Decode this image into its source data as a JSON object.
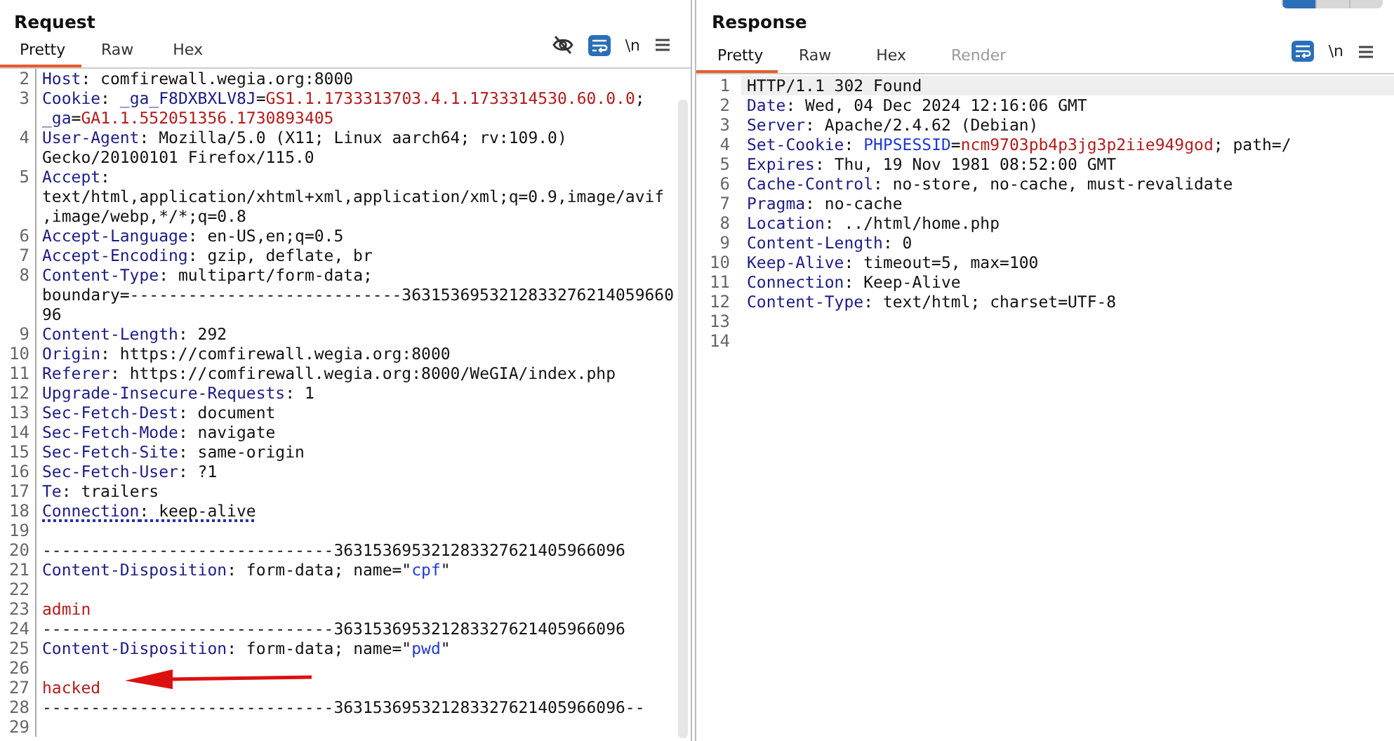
{
  "layout_buttons": [
    {
      "selected": true
    },
    {
      "selected": false
    },
    {
      "selected": false
    }
  ],
  "panels": [
    {
      "kind": "request",
      "title": "Request",
      "tabs": [
        {
          "label": "Pretty",
          "selected": true,
          "disabled": false
        },
        {
          "label": "Raw",
          "selected": false,
          "disabled": false
        },
        {
          "label": "Hex",
          "selected": false,
          "disabled": false
        }
      ],
      "tools": [
        {
          "kind": "hide"
        },
        {
          "kind": "wrap",
          "on": true
        },
        {
          "kind": "newline",
          "label": "\\n"
        },
        {
          "kind": "menu"
        }
      ],
      "lines": [
        {
          "number": "2",
          "marked": false,
          "highlighted": false,
          "rows": [
            {
              "segments": [
                {
                  "kind": "name",
                  "text": "Host"
                },
                {
                  "kind": "plain",
                  "text": ": comfirewall.wegia.org:8000"
                }
              ]
            }
          ]
        },
        {
          "number": "3",
          "marked": false,
          "highlighted": false,
          "rows": [
            {
              "segments": [
                {
                  "kind": "name",
                  "text": "Cookie"
                },
                {
                  "kind": "plain",
                  "text": ": "
                },
                {
                  "kind": "name",
                  "text": "_ga_F8DXBXLV8J"
                },
                {
                  "kind": "plain",
                  "text": "="
                },
                {
                  "kind": "value",
                  "text": "GS1.1.1733313703.4.1.1733314530.60.0.0"
                },
                {
                  "kind": "plain",
                  "text": ";"
                }
              ]
            },
            {
              "segments": [
                {
                  "kind": "name",
                  "text": "_ga"
                },
                {
                  "kind": "plain",
                  "text": "="
                },
                {
                  "kind": "value",
                  "text": "GA1.1.552051356.1730893405"
                }
              ]
            }
          ]
        },
        {
          "number": "4",
          "marked": false,
          "highlighted": false,
          "rows": [
            {
              "segments": [
                {
                  "kind": "name",
                  "text": "User-Agent"
                },
                {
                  "kind": "plain",
                  "text": ": Mozilla/5.0 (X11; Linux aarch64; rv:109.0)"
                }
              ]
            },
            {
              "segments": [
                {
                  "kind": "plain",
                  "text": "Gecko/20100101 Firefox/115.0"
                }
              ]
            }
          ]
        },
        {
          "number": "5",
          "marked": false,
          "highlighted": false,
          "rows": [
            {
              "segments": [
                {
                  "kind": "name",
                  "text": "Accept"
                },
                {
                  "kind": "plain",
                  "text": ":"
                }
              ]
            },
            {
              "segments": [
                {
                  "kind": "plain",
                  "text": "text/html,application/xhtml+xml,application/xml;q=0.9,image/avif"
                }
              ]
            },
            {
              "segments": [
                {
                  "kind": "plain",
                  "text": ",image/webp,*/*;q=0.8"
                }
              ]
            }
          ]
        },
        {
          "number": "6",
          "marked": false,
          "highlighted": false,
          "rows": [
            {
              "segments": [
                {
                  "kind": "name",
                  "text": "Accept-Language"
                },
                {
                  "kind": "plain",
                  "text": ": en-US,en;q=0.5"
                }
              ]
            }
          ]
        },
        {
          "number": "7",
          "marked": false,
          "highlighted": false,
          "rows": [
            {
              "segments": [
                {
                  "kind": "name",
                  "text": "Accept-Encoding"
                },
                {
                  "kind": "plain",
                  "text": ": gzip, deflate, br"
                }
              ]
            }
          ]
        },
        {
          "number": "8",
          "marked": false,
          "highlighted": false,
          "rows": [
            {
              "segments": [
                {
                  "kind": "name",
                  "text": "Content-Type"
                },
                {
                  "kind": "plain",
                  "text": ": multipart/form-data;"
                }
              ]
            },
            {
              "segments": [
                {
                  "kind": "plain",
                  "text": "boundary=----------------------------3631536953212833276214059660"
                }
              ]
            },
            {
              "segments": [
                {
                  "kind": "plain",
                  "text": "96"
                }
              ]
            }
          ]
        },
        {
          "number": "9",
          "marked": false,
          "highlighted": false,
          "rows": [
            {
              "segments": [
                {
                  "kind": "name",
                  "text": "Content-Length"
                },
                {
                  "kind": "plain",
                  "text": ": 292"
                }
              ]
            }
          ]
        },
        {
          "number": "10",
          "marked": false,
          "highlighted": false,
          "rows": [
            {
              "segments": [
                {
                  "kind": "name",
                  "text": "Origin"
                },
                {
                  "kind": "plain",
                  "text": ": https://comfirewall.wegia.org:8000"
                }
              ]
            }
          ]
        },
        {
          "number": "11",
          "marked": false,
          "highlighted": false,
          "rows": [
            {
              "segments": [
                {
                  "kind": "name",
                  "text": "Referer"
                },
                {
                  "kind": "plain",
                  "text": ": https://comfirewall.wegia.org:8000/WeGIA/index.php"
                }
              ]
            }
          ]
        },
        {
          "number": "12",
          "marked": false,
          "highlighted": false,
          "rows": [
            {
              "segments": [
                {
                  "kind": "name",
                  "text": "Upgrade-Insecure-Requests"
                },
                {
                  "kind": "plain",
                  "text": ": 1"
                }
              ]
            }
          ]
        },
        {
          "number": "13",
          "marked": false,
          "highlighted": false,
          "rows": [
            {
              "segments": [
                {
                  "kind": "name",
                  "text": "Sec-Fetch-Dest"
                },
                {
                  "kind": "plain",
                  "text": ": document"
                }
              ]
            }
          ]
        },
        {
          "number": "14",
          "marked": false,
          "highlighted": false,
          "rows": [
            {
              "segments": [
                {
                  "kind": "name",
                  "text": "Sec-Fetch-Mode"
                },
                {
                  "kind": "plain",
                  "text": ": navigate"
                }
              ]
            }
          ]
        },
        {
          "number": "15",
          "marked": false,
          "highlighted": false,
          "rows": [
            {
              "segments": [
                {
                  "kind": "name",
                  "text": "Sec-Fetch-Site"
                },
                {
                  "kind": "plain",
                  "text": ": same-origin"
                }
              ]
            }
          ]
        },
        {
          "number": "16",
          "marked": false,
          "highlighted": false,
          "rows": [
            {
              "segments": [
                {
                  "kind": "name",
                  "text": "Sec-Fetch-User"
                },
                {
                  "kind": "plain",
                  "text": ": ?1"
                }
              ]
            }
          ]
        },
        {
          "number": "17",
          "marked": false,
          "highlighted": false,
          "rows": [
            {
              "segments": [
                {
                  "kind": "name",
                  "text": "Te"
                },
                {
                  "kind": "plain",
                  "text": ": trailers"
                }
              ]
            }
          ]
        },
        {
          "number": "18",
          "marked": true,
          "highlighted": false,
          "rows": [
            {
              "segments": [
                {
                  "kind": "name",
                  "text": "Connection"
                },
                {
                  "kind": "plain",
                  "text": ": keep-alive"
                }
              ]
            }
          ]
        },
        {
          "number": "19",
          "marked": false,
          "highlighted": false
        },
        {
          "number": "20",
          "marked": false,
          "highlighted": false,
          "rows": [
            {
              "segments": [
                {
                  "kind": "plain",
                  "text": "------------------------------363153695321283327621405966096"
                }
              ]
            }
          ]
        },
        {
          "number": "21",
          "marked": false,
          "highlighted": false,
          "rows": [
            {
              "segments": [
                {
                  "kind": "name",
                  "text": "Content-Disposition"
                },
                {
                  "kind": "plain",
                  "text": ": form-data; name=\""
                },
                {
                  "kind": "attr",
                  "text": "cpf"
                },
                {
                  "kind": "plain",
                  "text": "\""
                }
              ]
            }
          ]
        },
        {
          "number": "22",
          "marked": false,
          "highlighted": false
        },
        {
          "number": "23",
          "marked": false,
          "highlighted": false,
          "rows": [
            {
              "segments": [
                {
                  "kind": "value",
                  "text": "admin"
                }
              ]
            }
          ]
        },
        {
          "number": "24",
          "marked": false,
          "highlighted": false,
          "rows": [
            {
              "segments": [
                {
                  "kind": "plain",
                  "text": "------------------------------363153695321283327621405966096"
                }
              ]
            }
          ]
        },
        {
          "number": "25",
          "marked": false,
          "highlighted": false,
          "rows": [
            {
              "segments": [
                {
                  "kind": "name",
                  "text": "Content-Disposition"
                },
                {
                  "kind": "plain",
                  "text": ": form-data; name=\""
                },
                {
                  "kind": "attr",
                  "text": "pwd"
                },
                {
                  "kind": "plain",
                  "text": "\""
                }
              ]
            }
          ]
        },
        {
          "number": "26",
          "marked": false,
          "highlighted": false
        },
        {
          "number": "27",
          "marked": false,
          "highlighted": false,
          "rows": [
            {
              "segments": [
                {
                  "kind": "value",
                  "text": "hacked"
                }
              ]
            }
          ]
        },
        {
          "number": "28",
          "marked": false,
          "highlighted": false,
          "rows": [
            {
              "segments": [
                {
                  "kind": "plain",
                  "text": "------------------------------363153695321283327621405966096--"
                }
              ]
            }
          ]
        },
        {
          "number": "29",
          "marked": false,
          "highlighted": false
        }
      ]
    },
    {
      "kind": "response",
      "title": "Response",
      "tabs": [
        {
          "label": "Pretty",
          "selected": true,
          "disabled": false
        },
        {
          "label": "Raw",
          "selected": false,
          "disabled": false
        },
        {
          "label": "Hex",
          "selected": false,
          "disabled": false
        },
        {
          "label": "Render",
          "selected": false,
          "disabled": true
        }
      ],
      "tools": [
        {
          "kind": "wrap",
          "on": true
        },
        {
          "kind": "newline",
          "label": "\\n"
        },
        {
          "kind": "menu"
        }
      ],
      "lines": [
        {
          "number": "1",
          "marked": false,
          "highlighted": true,
          "rows": [
            {
              "segments": [
                {
                  "kind": "plain",
                  "text": "HTTP/1.1 302 Found"
                }
              ]
            }
          ]
        },
        {
          "number": "2",
          "marked": false,
          "highlighted": false,
          "rows": [
            {
              "segments": [
                {
                  "kind": "name",
                  "text": "Date"
                },
                {
                  "kind": "plain",
                  "text": ": Wed, 04 Dec 2024 12:16:06 GMT"
                }
              ]
            }
          ]
        },
        {
          "number": "3",
          "marked": false,
          "highlighted": false,
          "rows": [
            {
              "segments": [
                {
                  "kind": "name",
                  "text": "Server"
                },
                {
                  "kind": "plain",
                  "text": ": Apache/2.4.62 (Debian)"
                }
              ]
            }
          ]
        },
        {
          "number": "4",
          "marked": false,
          "highlighted": false,
          "rows": [
            {
              "segments": [
                {
                  "kind": "name",
                  "text": "Set-Cookie"
                },
                {
                  "kind": "plain",
                  "text": ": "
                },
                {
                  "kind": "attr",
                  "text": "PHPSESSID"
                },
                {
                  "kind": "plain",
                  "text": "="
                },
                {
                  "kind": "value",
                  "text": "ncm9703pb4p3jg3p2iie949god"
                },
                {
                  "kind": "plain",
                  "text": "; path=/"
                }
              ]
            }
          ]
        },
        {
          "number": "5",
          "marked": false,
          "highlighted": false,
          "rows": [
            {
              "segments": [
                {
                  "kind": "name",
                  "text": "Expires"
                },
                {
                  "kind": "plain",
                  "text": ": Thu, 19 Nov 1981 08:52:00 GMT"
                }
              ]
            }
          ]
        },
        {
          "number": "6",
          "marked": false,
          "highlighted": false,
          "rows": [
            {
              "segments": [
                {
                  "kind": "name",
                  "text": "Cache-Control"
                },
                {
                  "kind": "plain",
                  "text": ": no-store, no-cache, must-revalidate"
                }
              ]
            }
          ]
        },
        {
          "number": "7",
          "marked": false,
          "highlighted": false,
          "rows": [
            {
              "segments": [
                {
                  "kind": "name",
                  "text": "Pragma"
                },
                {
                  "kind": "plain",
                  "text": ": no-cache"
                }
              ]
            }
          ]
        },
        {
          "number": "8",
          "marked": false,
          "highlighted": false,
          "rows": [
            {
              "segments": [
                {
                  "kind": "name",
                  "text": "Location"
                },
                {
                  "kind": "plain",
                  "text": ": ../html/home.php"
                }
              ]
            }
          ]
        },
        {
          "number": "9",
          "marked": false,
          "highlighted": false,
          "rows": [
            {
              "segments": [
                {
                  "kind": "name",
                  "text": "Content-Length"
                },
                {
                  "kind": "plain",
                  "text": ": 0"
                }
              ]
            }
          ]
        },
        {
          "number": "10",
          "marked": false,
          "highlighted": false,
          "rows": [
            {
              "segments": [
                {
                  "kind": "name",
                  "text": "Keep-Alive"
                },
                {
                  "kind": "plain",
                  "text": ": timeout=5, max=100"
                }
              ]
            }
          ]
        },
        {
          "number": "11",
          "marked": false,
          "highlighted": false,
          "rows": [
            {
              "segments": [
                {
                  "kind": "name",
                  "text": "Connection"
                },
                {
                  "kind": "plain",
                  "text": ": Keep-Alive"
                }
              ]
            }
          ]
        },
        {
          "number": "12",
          "marked": false,
          "highlighted": false,
          "rows": [
            {
              "segments": [
                {
                  "kind": "name",
                  "text": "Content-Type"
                },
                {
                  "kind": "plain",
                  "text": ": text/html; charset=UTF-8"
                }
              ]
            }
          ]
        },
        {
          "number": "13",
          "marked": false,
          "highlighted": false
        },
        {
          "number": "14",
          "marked": false,
          "highlighted": false
        }
      ]
    }
  ]
}
